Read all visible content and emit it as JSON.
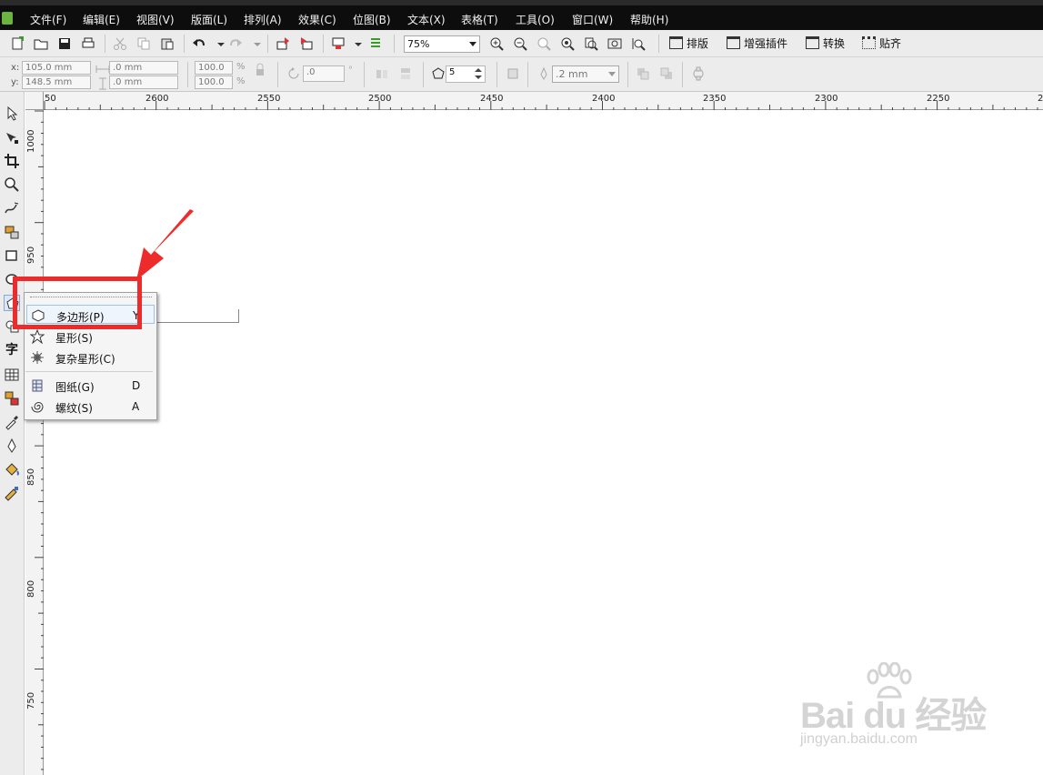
{
  "menubar": {
    "items": [
      "文件(F)",
      "编辑(E)",
      "视图(V)",
      "版面(L)",
      "排列(A)",
      "效果(C)",
      "位图(B)",
      "文本(X)",
      "表格(T)",
      "工具(O)",
      "窗口(W)",
      "帮助(H)"
    ]
  },
  "toolbar": {
    "zoom_value": "75%",
    "plugins": [
      "排版",
      "增强插件",
      "转换",
      "贴齐"
    ]
  },
  "property_bar": {
    "x_label": "x:",
    "y_label": "y:",
    "x_value": "105.0 mm",
    "y_value": "148.5 mm",
    "width_value": ".0 mm",
    "height_value": ".0 mm",
    "scale_w": "100.0",
    "scale_h": "100.0",
    "percent_sign": "%",
    "rotation_value": ".0",
    "degree_sign": "°",
    "polygon_sides": "5",
    "outline_width": ".2 mm"
  },
  "rulers": {
    "h_labels": [
      "50",
      "2600",
      "2550",
      "2500",
      "2450",
      "2400",
      "2350",
      "2300",
      "2250",
      "2"
    ],
    "v_labels": [
      "1000",
      "950",
      "850",
      "800",
      "750"
    ]
  },
  "toolbox": {
    "text_tool_glyph": "字"
  },
  "flyout": {
    "items": [
      {
        "label": "多边形(P)",
        "shortcut": "Y"
      },
      {
        "label": "星形(S)",
        "shortcut": ""
      },
      {
        "label": "复杂星形(C)",
        "shortcut": ""
      },
      {
        "label": "图纸(G)",
        "shortcut": "D"
      },
      {
        "label": "螺纹(S)",
        "shortcut": "A"
      }
    ]
  },
  "annotation": {
    "color": "#ee2b2b"
  },
  "watermark": {
    "brand": "Bai du 经验",
    "url": "jingyan.baidu.com"
  }
}
